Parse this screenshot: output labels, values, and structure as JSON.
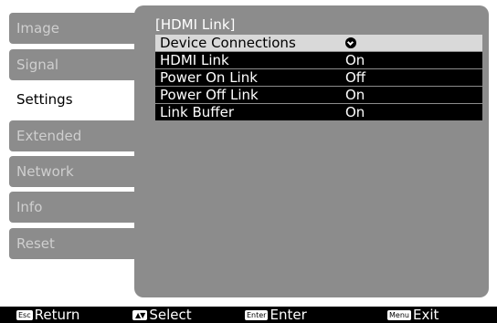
{
  "sidebar": {
    "items": [
      {
        "label": "Image",
        "active": false
      },
      {
        "label": "Signal",
        "active": false
      },
      {
        "label": "Settings",
        "active": true
      },
      {
        "label": "Extended",
        "active": false
      },
      {
        "label": "Network",
        "active": false
      },
      {
        "label": "Info",
        "active": false
      },
      {
        "label": "Reset",
        "active": false
      }
    ]
  },
  "panel": {
    "title": "[HDMI Link]",
    "rows": [
      {
        "label": "Device Connections",
        "value": "",
        "icon": "enter-icon",
        "selected": true
      },
      {
        "label": "HDMI Link",
        "value": "On",
        "selected": false
      },
      {
        "label": "Power On Link",
        "value": "Off",
        "selected": false
      },
      {
        "label": "Power Off Link",
        "value": "On",
        "selected": false
      },
      {
        "label": "Link Buffer",
        "value": "On",
        "selected": false
      }
    ]
  },
  "keybar": {
    "return": {
      "badge": "Esc",
      "label": "Return"
    },
    "select": {
      "badge": "▲▼",
      "label": "Select"
    },
    "enter": {
      "badge": "Enter",
      "label": "Enter"
    },
    "exit": {
      "badge": "Menu",
      "label": "Exit"
    }
  },
  "colors": {
    "panel_bg": "#8c8c8c",
    "row_bg": "#000000",
    "selected_row_bg": "#d9d9d9",
    "text": "#ffffff"
  }
}
